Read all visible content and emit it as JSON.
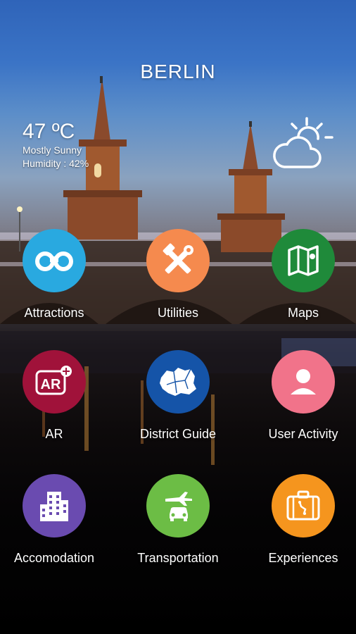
{
  "header": {
    "city": "BERLIN"
  },
  "weather": {
    "temperature": "47 ºC",
    "condition": "Mostly Sunny",
    "humidity": "Humidity : 42%",
    "icon": "partly-sunny-icon"
  },
  "menu": {
    "attractions": {
      "label": "Attractions",
      "icon": "binoculars-icon",
      "color": "#29a9e0"
    },
    "utilities": {
      "label": "Utilities",
      "icon": "tools-icon",
      "color": "#f58a4e"
    },
    "maps": {
      "label": "Maps",
      "icon": "map-icon",
      "color": "#1f8a3a"
    },
    "ar": {
      "label": "AR",
      "icon": "ar-icon",
      "color": "#a0123a"
    },
    "district_guide": {
      "label": "District Guide",
      "icon": "district-map-icon",
      "color": "#1554a8"
    },
    "user_activity": {
      "label": "User Activity",
      "icon": "user-icon",
      "color": "#f1738a"
    },
    "accomodation": {
      "label": "Accomodation",
      "icon": "building-icon",
      "color": "#6a4bb0"
    },
    "transportation": {
      "label": "Transportation",
      "icon": "transport-icon",
      "color": "#6cbd45"
    },
    "experiences": {
      "label": "Experiences",
      "icon": "suitcase-icon",
      "color": "#f5951e"
    }
  }
}
